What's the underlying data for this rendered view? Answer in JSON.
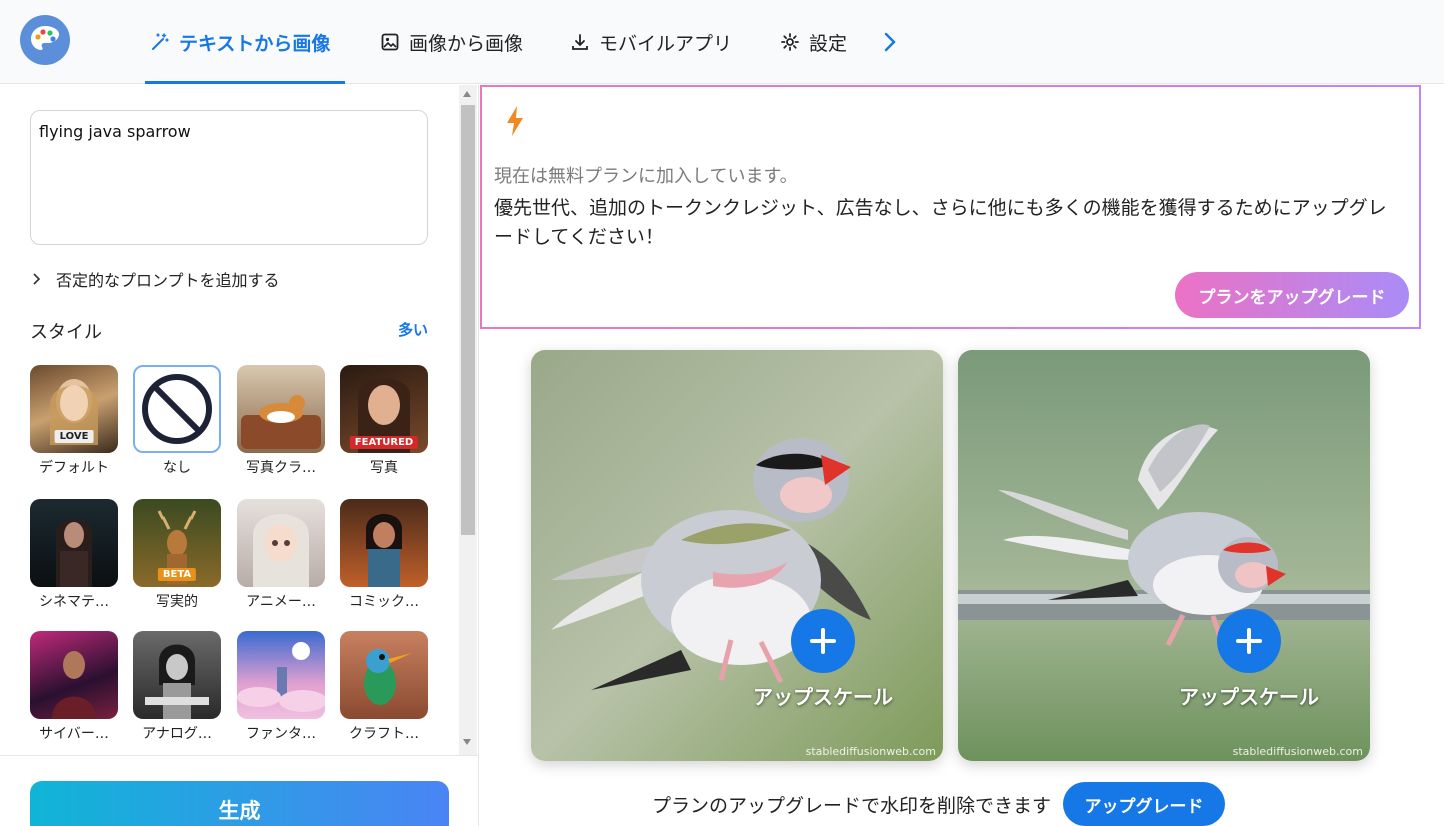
{
  "header": {
    "tabs": [
      {
        "label": "テキストから画像",
        "icon": "magic-wand-icon",
        "active": true
      },
      {
        "label": "画像から画像",
        "icon": "image-icon",
        "active": false
      },
      {
        "label": "モバイルアプリ",
        "icon": "download-icon",
        "active": false
      },
      {
        "label": "設定",
        "icon": "gear-icon",
        "active": false
      }
    ],
    "accent": "#1677e6"
  },
  "sidebar": {
    "prompt_value": "flying java sparrow",
    "negative_prompt_label": "否定的なプロンプトを追加する",
    "style_title": "スタイル",
    "style_more": "多い",
    "styles": [
      {
        "label": "デフォルト",
        "badge": "LOVE"
      },
      {
        "label": "なし",
        "selected": true
      },
      {
        "label": "写真クラ…"
      },
      {
        "label": "写真",
        "badge": "FEATURED"
      },
      {
        "label": "シネマテ…"
      },
      {
        "label": "写実的",
        "badge": "BETA"
      },
      {
        "label": "アニメー…"
      },
      {
        "label": "コミック…"
      },
      {
        "label": "サイバー…"
      },
      {
        "label": "アナログ…"
      },
      {
        "label": "ファンタ…"
      },
      {
        "label": "クラフト…"
      }
    ],
    "generate_label": "生成"
  },
  "main": {
    "promo": {
      "subtitle": "現在は無料プランに加入しています。",
      "message": "優先世代、追加のトークンクレジット、広告なし、さらに他にも多くの機能を獲得するためにアップグレードしてください！",
      "button_label": "プランをアップグレード"
    },
    "results": [
      {
        "upscale_label": "アップスケール",
        "watermark": "stablediffusionweb.com"
      },
      {
        "upscale_label": "アップスケール",
        "watermark": "stablediffusionweb.com"
      }
    ],
    "watermark_notice": "プランのアップグレードで水印を削除できます",
    "watermark_button": "アップグレード"
  }
}
